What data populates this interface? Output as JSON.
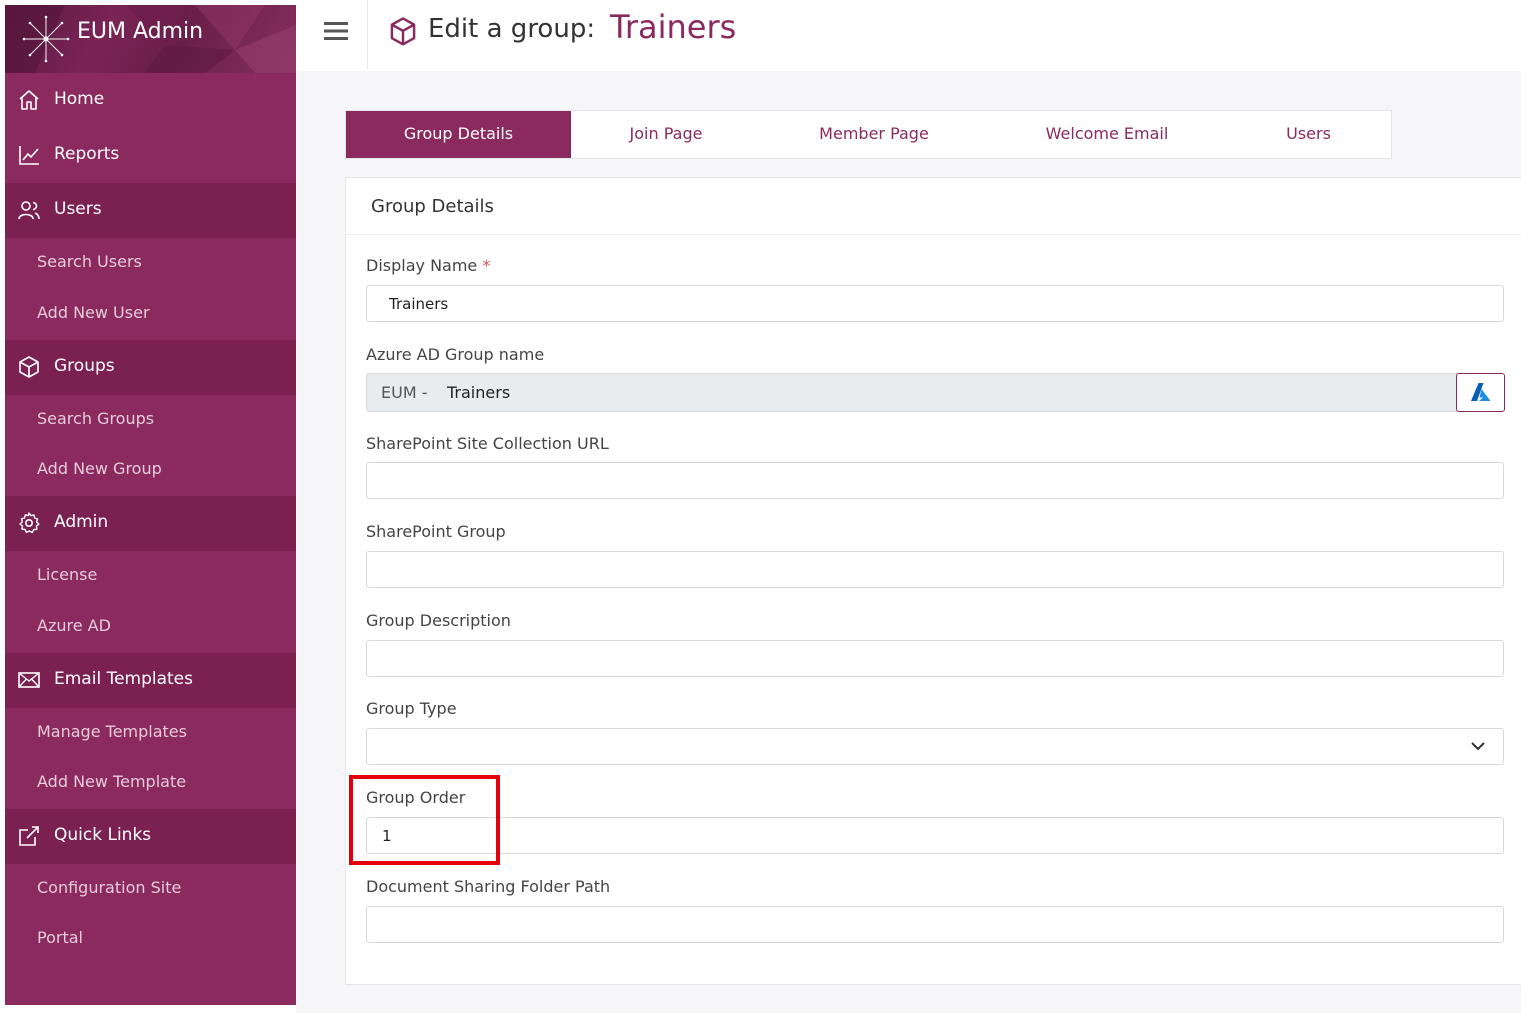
{
  "app": {
    "title": "EUM Admin"
  },
  "sidebar": {
    "sections": [
      {
        "label": "Home",
        "icon": "home-icon"
      },
      {
        "label": "Reports",
        "icon": "chart-line-icon"
      },
      {
        "label": "Users",
        "icon": "users-icon",
        "items": [
          "Search Users",
          "Add New User"
        ]
      },
      {
        "label": "Groups",
        "icon": "box-icon",
        "items": [
          "Search Groups",
          "Add New Group"
        ]
      },
      {
        "label": "Admin",
        "icon": "gear-icon",
        "items": [
          "License",
          "Azure AD"
        ]
      },
      {
        "label": "Email Templates",
        "icon": "envelope-icon",
        "items": [
          "Manage Templates",
          "Add New Template"
        ]
      },
      {
        "label": "Quick Links",
        "icon": "external-link-icon",
        "items": [
          "Configuration Site",
          "Portal"
        ]
      }
    ]
  },
  "header": {
    "prefix": "Edit a group:",
    "group_name": "Trainers"
  },
  "tabs": [
    "Group Details",
    "Join Page",
    "Member Page",
    "Welcome Email",
    "Users"
  ],
  "active_tab": "Group Details",
  "card": {
    "title": "Group Details",
    "fields": {
      "display_name": {
        "label": "Display Name",
        "required_mark": "*",
        "value": "Trainers"
      },
      "azure_group": {
        "label": "Azure AD Group name",
        "prefix": "EUM -",
        "value": "Trainers"
      },
      "sharepoint_url": {
        "label": "SharePoint Site Collection URL",
        "value": ""
      },
      "sharepoint_group": {
        "label": "SharePoint Group",
        "value": ""
      },
      "description": {
        "label": "Group Description",
        "value": ""
      },
      "group_type": {
        "label": "Group Type",
        "value": ""
      },
      "group_order": {
        "label": "Group Order",
        "value": "1"
      },
      "folder_path": {
        "label": "Document Sharing Folder Path",
        "value": ""
      }
    }
  },
  "colors": {
    "brand": "#8a2a5e",
    "sidebar_section": "#7a2151",
    "highlight": "#e3000b"
  }
}
